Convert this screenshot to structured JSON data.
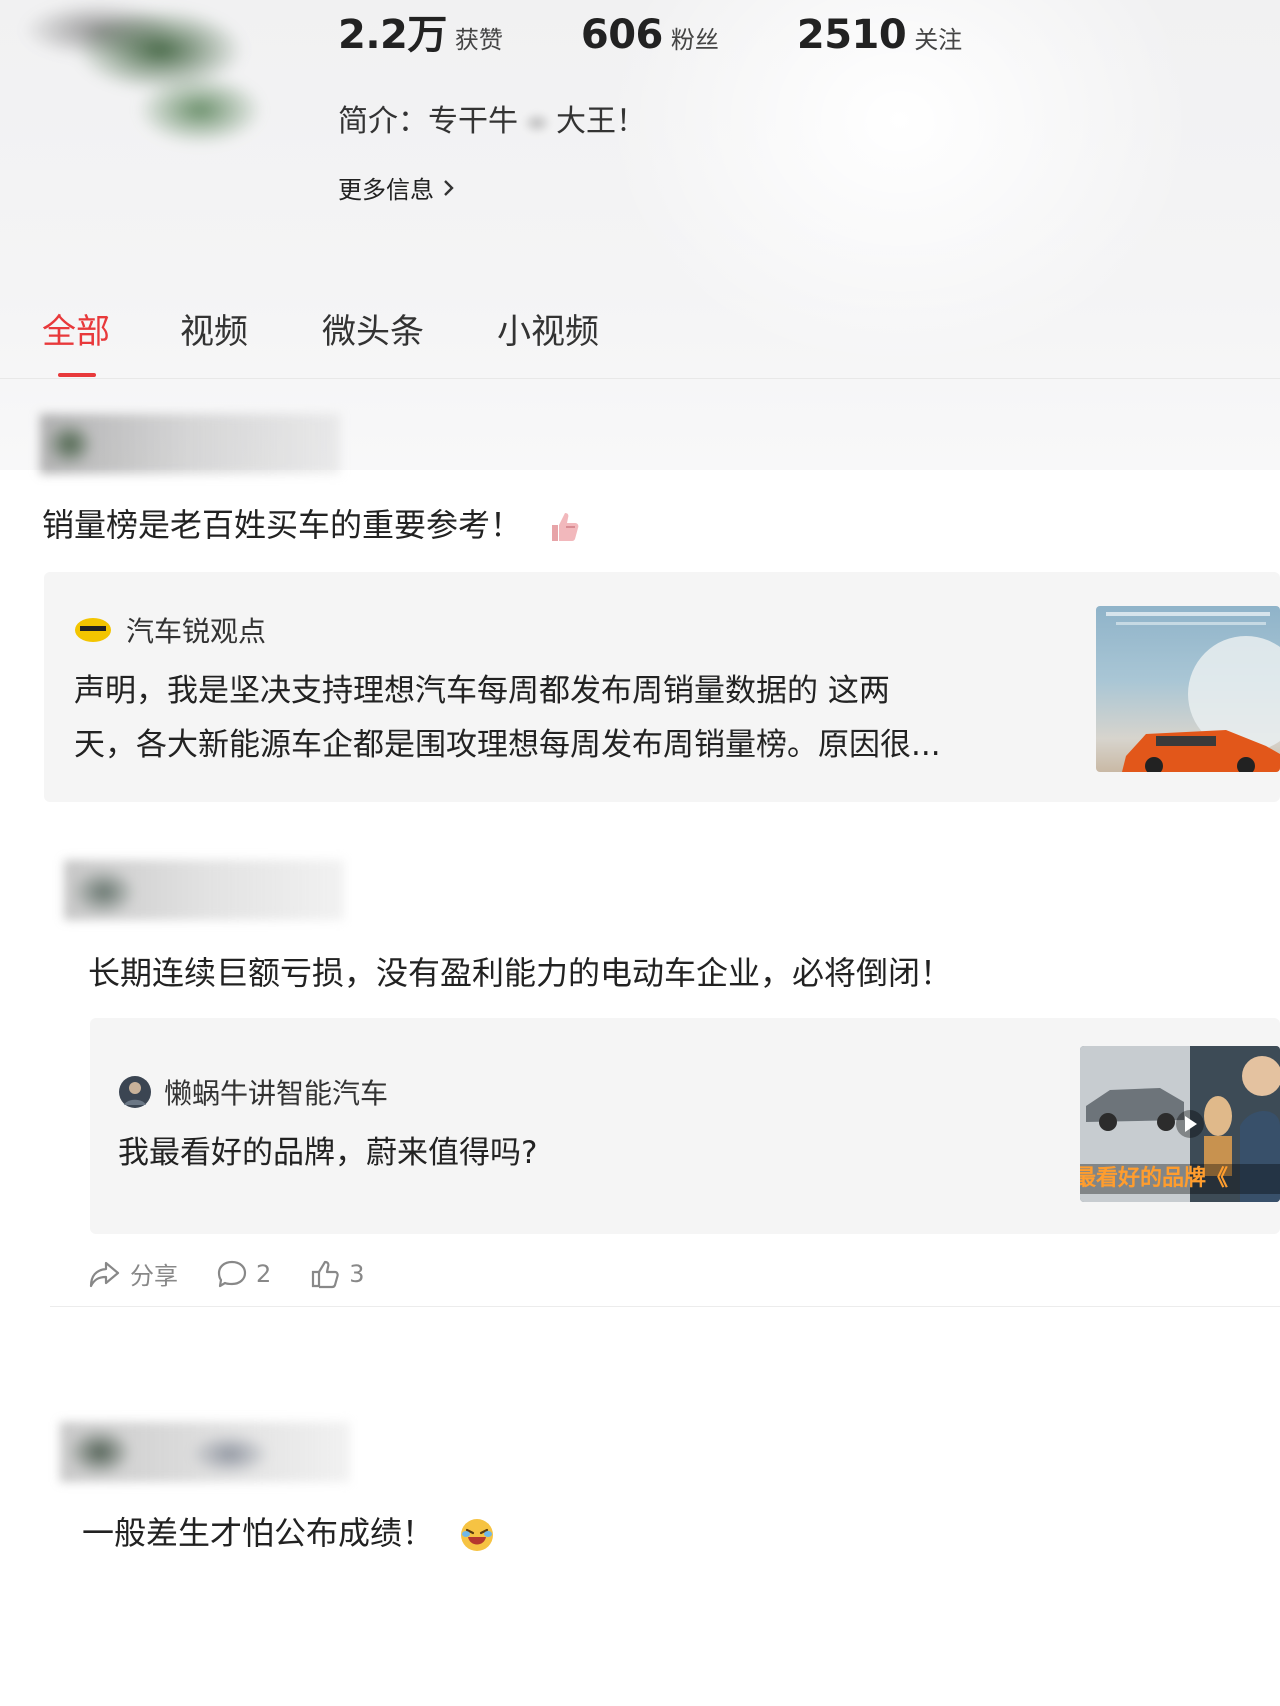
{
  "profile": {
    "stats": [
      {
        "value": "2.2万",
        "label": "获赞"
      },
      {
        "value": "606",
        "label": "粉丝"
      },
      {
        "value": "2510",
        "label": "关注"
      }
    ],
    "bio_prefix": "简介：专干牛",
    "bio_suffix": "大王！",
    "more_info": "更多信息",
    "more_icon": "chevron-right-icon"
  },
  "tabs": [
    {
      "label": "全部",
      "active": true
    },
    {
      "label": "视频",
      "active": false
    },
    {
      "label": "微头条",
      "active": false
    },
    {
      "label": "小视频",
      "active": false
    }
  ],
  "colors": {
    "accent": "#e8393b",
    "card_bg": "#f5f5f5",
    "muted": "#888888"
  },
  "feed": [
    {
      "text": "销量榜是老百姓买车的重要参考！",
      "emoji": "thumbs-up-icon",
      "quote": {
        "author": "汽车锐观点",
        "author_icon": "yellow-logo-icon",
        "text_line1": "声明，我是坚决支持理想汽车每周都发布周销量数据的 这两",
        "text_line2": "天，各大新能源车企都是围攻理想每周发布周销量榜。原因很..."
      }
    },
    {
      "text": "长期连续巨额亏损，没有盈利能力的电动车企业，必将倒闭！",
      "quote": {
        "author": "懒蜗牛讲智能汽车",
        "author_icon": "avatar-icon",
        "text": "我最看好的品牌，蔚来值得吗?",
        "thumb_caption": "最看好的品牌《"
      },
      "actions": {
        "share": "分享",
        "comments": "2",
        "likes": "3"
      }
    },
    {
      "text": "一般差生才怕公布成绩！",
      "emoji": "laughing-emoji-icon"
    }
  ]
}
